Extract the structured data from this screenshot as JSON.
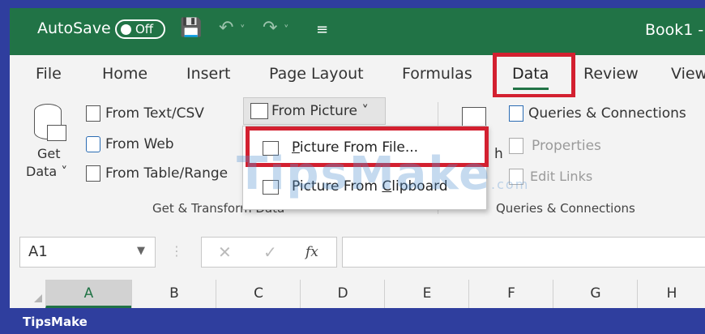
{
  "titlebar": {
    "autosave_label": "AutoSave",
    "autosave_state": "Off",
    "book_title": "Book1 -"
  },
  "tabs": [
    {
      "label": "File"
    },
    {
      "label": "Home"
    },
    {
      "label": "Insert"
    },
    {
      "label": "Page Layout"
    },
    {
      "label": "Formulas"
    },
    {
      "label": "Data",
      "active": true
    },
    {
      "label": "Review"
    },
    {
      "label": "View"
    }
  ],
  "ribbon": {
    "get_data_line1": "Get",
    "get_data_line2": "Data ˅",
    "from_text_csv": "From Text/CSV",
    "from_web": "From Web",
    "from_table_range": "From Table/Range",
    "from_picture": "From Picture ˅",
    "group_get_transform": "Get & Transform Data",
    "refresh_letter": "h",
    "queries_connections": "Queries & Connections",
    "properties": "Properties",
    "edit_links": "Edit Links",
    "group_queries": "Queries & Connections"
  },
  "dropdown": {
    "item1_prefix": "P",
    "item1_rest": "icture From File...",
    "item2_prefix": "Picture From ",
    "item2_u": "C",
    "item2_rest": "lipboard"
  },
  "watermark": {
    "main": "TipsMake",
    "suffix": ".com"
  },
  "formula_bar": {
    "name_box": "A1",
    "fx": "fx"
  },
  "columns": [
    "A",
    "B",
    "C",
    "D",
    "E",
    "F",
    "G",
    "H"
  ],
  "footer": {
    "brand": "TipsMake"
  },
  "colors": {
    "excel_green": "#217346",
    "highlight_red": "#d32030",
    "frame_blue": "#2f3e9e"
  }
}
